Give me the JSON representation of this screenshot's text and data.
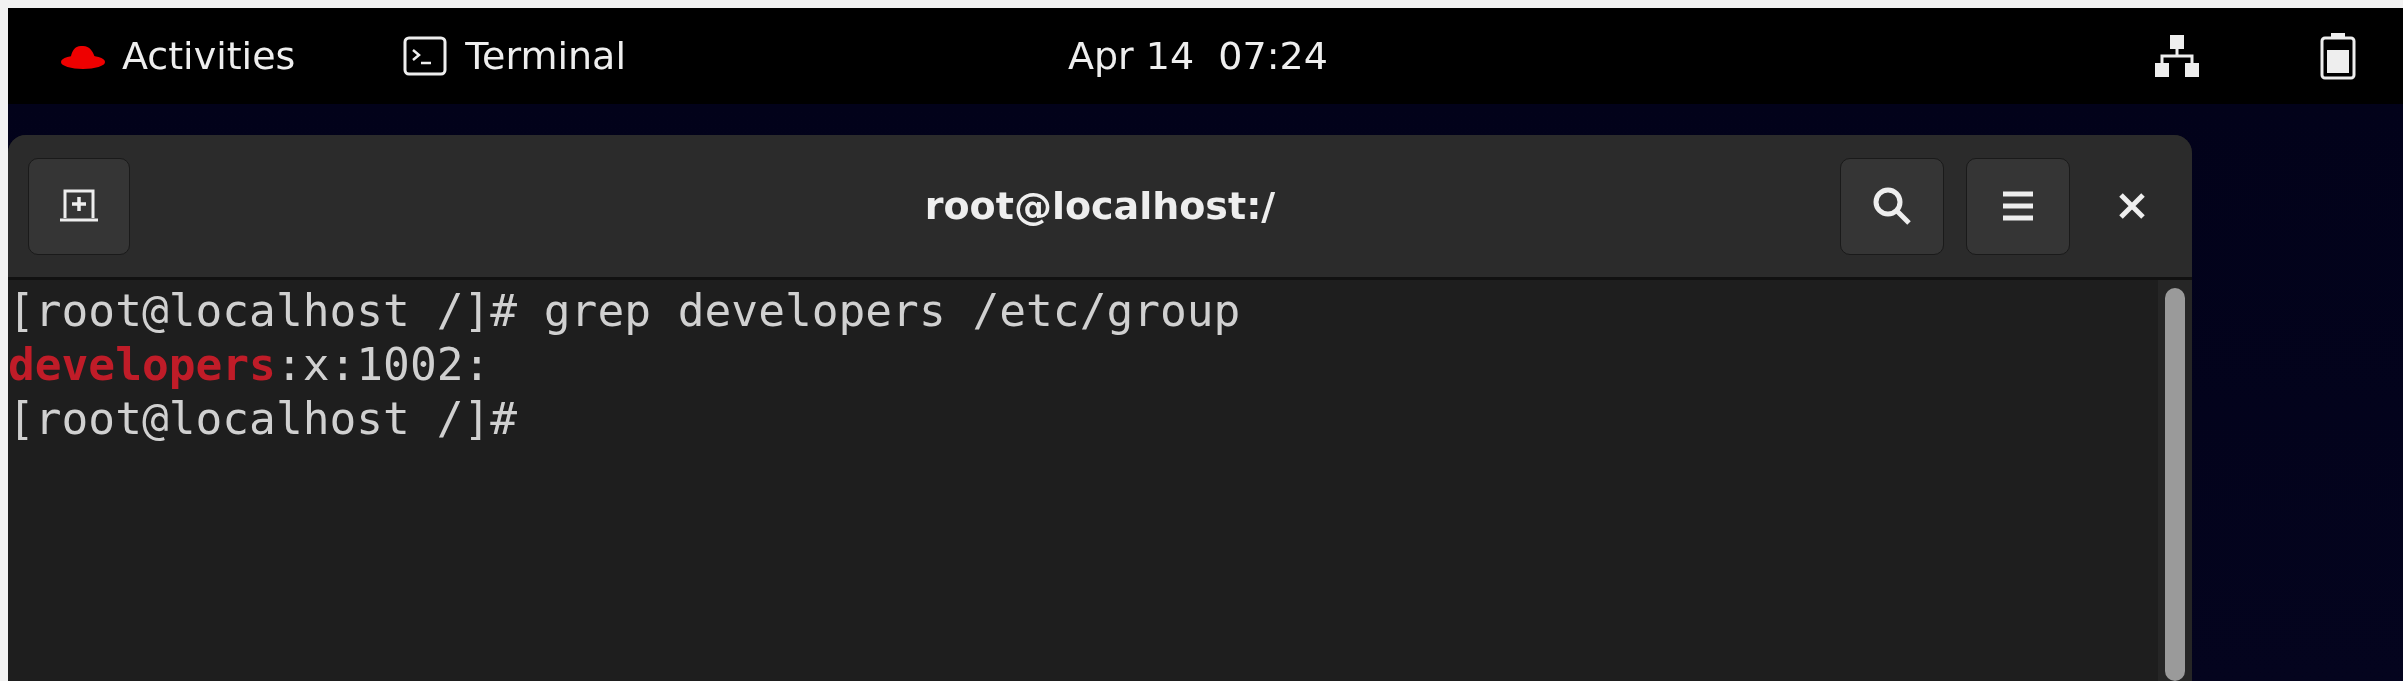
{
  "top_bar": {
    "activities": "Activities",
    "app": "Terminal",
    "clock": "Apr 14  07:24"
  },
  "window": {
    "title": "root@localhost:/"
  },
  "terminal": {
    "lines": [
      {
        "segments": [
          {
            "text": "[root@localhost /]# grep developers /etc/group",
            "highlight": false
          }
        ]
      },
      {
        "segments": [
          {
            "text": "developers",
            "highlight": true
          },
          {
            "text": ":x:1002:",
            "highlight": false
          }
        ]
      },
      {
        "segments": [
          {
            "text": "[root@localhost /]#",
            "highlight": false
          }
        ]
      }
    ]
  }
}
